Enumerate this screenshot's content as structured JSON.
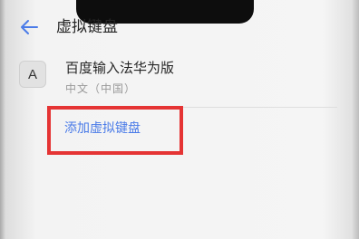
{
  "header": {
    "title": "虚拟键盘",
    "back_icon": "back-arrow-icon",
    "accent_color": "#4a7be8"
  },
  "keyboard_list": {
    "items": [
      {
        "icon_letter": "A",
        "name": "百度输入法华为版",
        "language": "中文（中国）"
      }
    ]
  },
  "actions": {
    "add_label": "添加虚拟键盘"
  },
  "annotation": {
    "color": "#e53434"
  }
}
